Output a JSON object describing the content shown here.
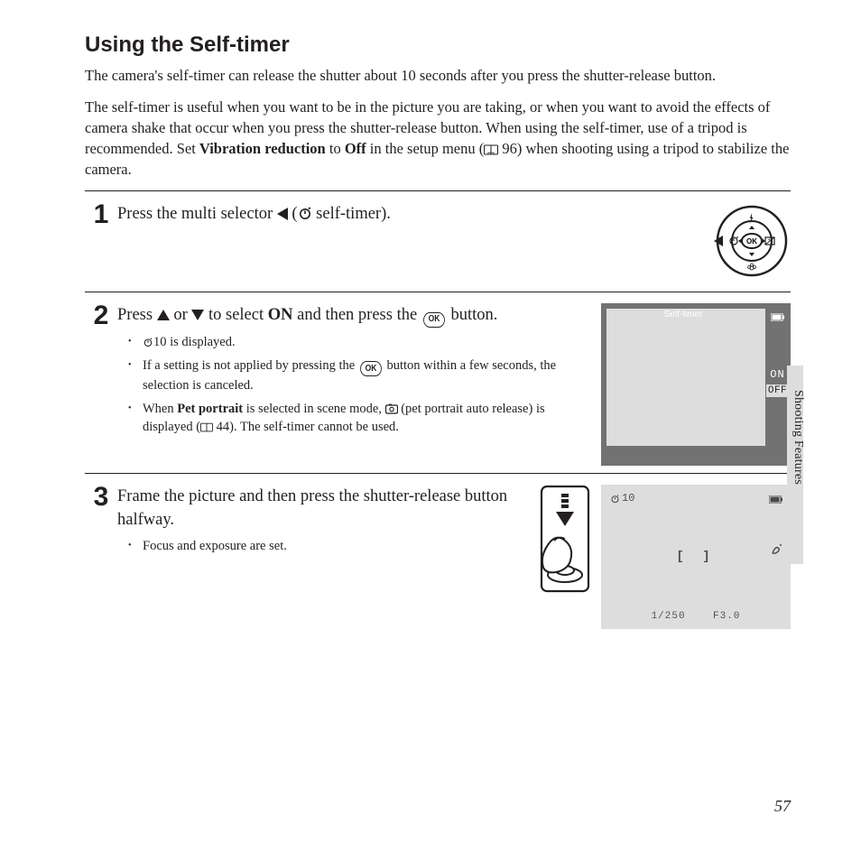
{
  "headings": {
    "title": "Using the Self-timer"
  },
  "intro": {
    "p1": "The camera's self-timer can release the shutter about 10 seconds after you press the shutter-release button.",
    "p2a": "The self-timer is useful when you want to be in the picture you are taking, or when you want to avoid the effects of camera shake that occur when you press the shutter-release button. When using the self-timer, use of a tripod is recommended. Set ",
    "p2_bold1": "Vibration reduction",
    "p2b": " to ",
    "p2_bold2": "Off",
    "p2c": " in the setup menu (",
    "p2_ref": "96",
    "p2d": ") when shooting using a tripod to stabilize the camera."
  },
  "steps": {
    "s1": {
      "num": "1",
      "instr_a": "Press the multi selector ",
      "instr_b": " (",
      "instr_c": " self-timer)."
    },
    "s2": {
      "num": "2",
      "instr_a": "Press ",
      "instr_or": " or ",
      "instr_b": " to select ",
      "instr_on": "ON",
      "instr_c": " and then press the ",
      "instr_d": " button.",
      "note1_a": "10 is displayed.",
      "note2_a": "If a setting is not applied by pressing the ",
      "note2_b": " button within a few seconds, the selection is canceled.",
      "note3_a": "When ",
      "note3_bold": "Pet portrait",
      "note3_b": " is selected in scene mode, ",
      "note3_c": " (pet portrait auto release) is displayed (",
      "note3_ref": "44",
      "note3_d": "). The self-timer cannot be used."
    },
    "s3": {
      "num": "3",
      "instr": "Frame the picture and then press the shutter-release button halfway.",
      "note1": "Focus and exposure are set."
    }
  },
  "screens": {
    "s2": {
      "title": "Self-timer",
      "on": "ON",
      "off": "OFF"
    },
    "s3": {
      "timer": "10",
      "bracket": "[  ]",
      "shutter": "1/250",
      "fstop": "F3.0"
    }
  },
  "side": {
    "section": "Shooting Features"
  },
  "page": {
    "number": "57"
  }
}
